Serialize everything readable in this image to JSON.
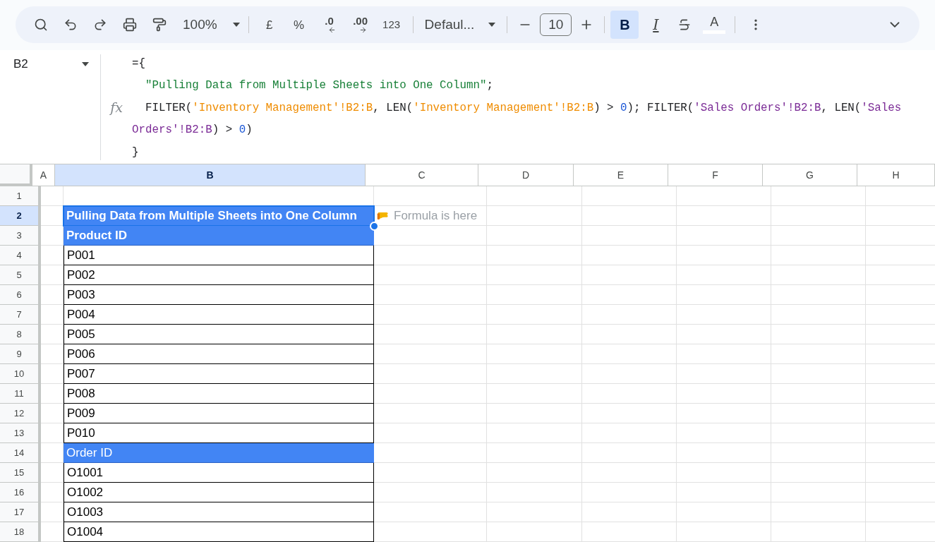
{
  "toolbar": {
    "zoom": "100%",
    "currency": "£",
    "percent": "%",
    "decrease_decimals": ".0",
    "increase_decimals": ".00",
    "number_format": "123",
    "font": "Defaul...",
    "font_size": "10",
    "bold": {
      "label": "B",
      "selected": true
    },
    "italic": {
      "label": "I",
      "selected": false
    },
    "text_color": {
      "label": "A"
    }
  },
  "name_box": "B2",
  "function_label": "fx",
  "formula": [
    {
      "segments": [
        {
          "kind": "plain",
          "text": "={"
        }
      ]
    },
    {
      "segments": [
        {
          "kind": "string",
          "text": "  \"Pulling Data from Multiple Sheets into One Column\""
        },
        {
          "kind": "plain",
          "text": ";"
        }
      ]
    },
    {
      "segments": [
        {
          "kind": "plain",
          "text": "  FILTER("
        },
        {
          "kind": "ref",
          "text": "'Inventory Management'!B2:B"
        },
        {
          "kind": "plain",
          "text": ", LEN("
        },
        {
          "kind": "ref",
          "text": "'Inventory Management'!B2:B"
        },
        {
          "kind": "plain",
          "text": ") > "
        },
        {
          "kind": "number",
          "text": "0"
        },
        {
          "kind": "plain",
          "text": "); FILTER("
        },
        {
          "kind": "ref_alt",
          "text": "'Sales Orders'!B2:B"
        },
        {
          "kind": "plain",
          "text": ", LEN("
        },
        {
          "kind": "ref_alt",
          "text": "'Sales"
        }
      ]
    },
    {
      "segments": [
        {
          "kind": "ref_alt",
          "text": "Orders'!B2:B"
        },
        {
          "kind": "plain",
          "text": ") > "
        },
        {
          "kind": "number",
          "text": "0"
        },
        {
          "kind": "plain",
          "text": ")"
        }
      ]
    },
    {
      "segments": [
        {
          "kind": "plain",
          "text": "}"
        }
      ]
    }
  ],
  "columns": [
    {
      "label": "A",
      "selected": false
    },
    {
      "label": "B",
      "selected": true
    },
    {
      "label": "C",
      "selected": false
    },
    {
      "label": "D",
      "selected": false
    },
    {
      "label": "E",
      "selected": false
    },
    {
      "label": "F",
      "selected": false
    },
    {
      "label": "G",
      "selected": false
    },
    {
      "label": "H",
      "selected": false
    }
  ],
  "rows": [
    {
      "label": "1",
      "selected": false
    },
    {
      "label": "2",
      "selected": true,
      "b": {
        "text": "Pulling Data from Multiple Sheets into One Column",
        "kind": "header",
        "bold": true,
        "selected": true
      },
      "note": "Formula is here"
    },
    {
      "label": "3",
      "selected": false,
      "b": {
        "text": "Product ID",
        "kind": "header",
        "bold": true,
        "selected": false
      }
    },
    {
      "label": "4",
      "selected": false,
      "b": {
        "text": "P001",
        "kind": "value",
        "bold": false,
        "selected": false
      }
    },
    {
      "label": "5",
      "selected": false,
      "b": {
        "text": "P002",
        "kind": "value",
        "bold": false,
        "selected": false
      }
    },
    {
      "label": "6",
      "selected": false,
      "b": {
        "text": "P003",
        "kind": "value",
        "bold": false,
        "selected": false
      }
    },
    {
      "label": "7",
      "selected": false,
      "b": {
        "text": "P004",
        "kind": "value",
        "bold": false,
        "selected": false
      }
    },
    {
      "label": "8",
      "selected": false,
      "b": {
        "text": "P005",
        "kind": "value",
        "bold": false,
        "selected": false
      }
    },
    {
      "label": "9",
      "selected": false,
      "b": {
        "text": "P006",
        "kind": "value",
        "bold": false,
        "selected": false
      }
    },
    {
      "label": "10",
      "selected": false,
      "b": {
        "text": "P007",
        "kind": "value",
        "bold": false,
        "selected": false
      }
    },
    {
      "label": "11",
      "selected": false,
      "b": {
        "text": "P008",
        "kind": "value",
        "bold": false,
        "selected": false
      }
    },
    {
      "label": "12",
      "selected": false,
      "b": {
        "text": "P009",
        "kind": "value",
        "bold": false,
        "selected": false
      }
    },
    {
      "label": "13",
      "selected": false,
      "b": {
        "text": "P010",
        "kind": "value",
        "bold": false,
        "selected": false
      }
    },
    {
      "label": "14",
      "selected": false,
      "b": {
        "text": "Order ID",
        "kind": "header",
        "bold": false,
        "selected": false
      }
    },
    {
      "label": "15",
      "selected": false,
      "b": {
        "text": "O1001",
        "kind": "value",
        "bold": false,
        "selected": false
      }
    },
    {
      "label": "16",
      "selected": false,
      "b": {
        "text": "O1002",
        "kind": "value",
        "bold": false,
        "selected": false
      }
    },
    {
      "label": "17",
      "selected": false,
      "b": {
        "text": "O1003",
        "kind": "value",
        "bold": false,
        "selected": false
      }
    },
    {
      "label": "18",
      "selected": false,
      "b": {
        "text": "O1004",
        "kind": "value",
        "bold": false,
        "selected": false
      }
    }
  ]
}
